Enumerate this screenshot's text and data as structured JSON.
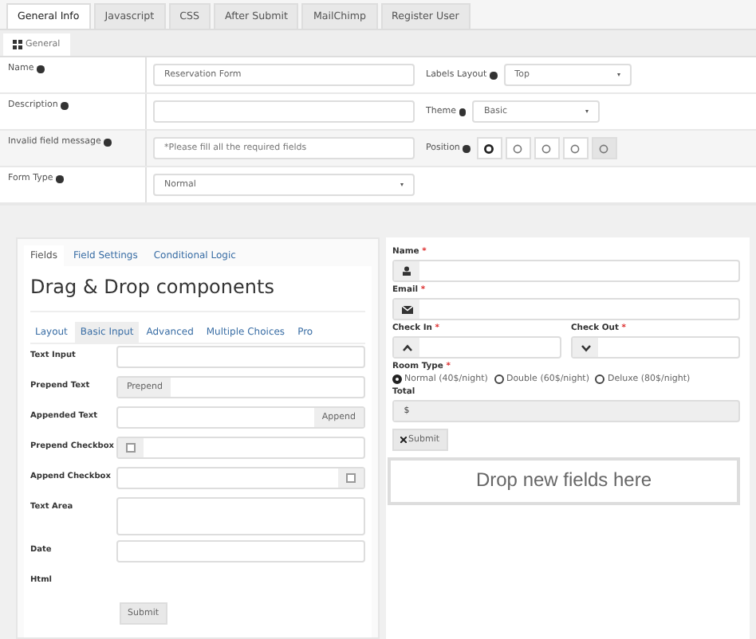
{
  "tabs": [
    {
      "label": "General Info",
      "selected": true
    },
    {
      "label": "Javascript",
      "selected": false
    },
    {
      "label": "CSS",
      "selected": false
    },
    {
      "label": "After Submit",
      "selected": false
    },
    {
      "label": "MailChimp",
      "selected": false
    },
    {
      "label": "Register User",
      "selected": false
    }
  ],
  "subtab": {
    "label": "General",
    "selected": true
  },
  "settings": [
    {
      "label": "Name",
      "kind": "text",
      "value": "Reservation Form",
      "side": {
        "label": "Labels Layout",
        "kind": "select",
        "value": "Top"
      }
    },
    {
      "label": "Description",
      "kind": "text",
      "side": {
        "label": "Theme",
        "kind": "select",
        "value": "Basic"
      }
    },
    {
      "label": "Invalid field message",
      "kind": "text",
      "placeholder": "*Please fill all the required fields",
      "side": {
        "label": "Position",
        "kind": "position",
        "buttons": [
          {
            "selected": false
          },
          {
            "selected": false
          },
          {
            "selected": false
          },
          {
            "selected": false
          },
          {
            "selected": true
          }
        ]
      }
    },
    {
      "label": "Form Type",
      "kind": "select",
      "value": "Normal"
    }
  ],
  "builder": {
    "tabs": [
      {
        "label": "Fields",
        "selected": true
      },
      {
        "label": "Field Settings",
        "selected": false
      },
      {
        "label": "Conditional Logic",
        "selected": false
      }
    ],
    "heading": "Drag & Drop components",
    "categories": [
      {
        "label": "Layout",
        "selected": false
      },
      {
        "label": "Basic Input",
        "selected": true
      },
      {
        "label": "Advanced",
        "selected": false
      },
      {
        "label": "Multiple Choices",
        "selected": false
      },
      {
        "label": "Pro",
        "selected": false
      }
    ],
    "components": [
      {
        "label": "Text Input",
        "kind": "input"
      },
      {
        "label": "Prepend Text",
        "kind": "prepend",
        "addon": "Prepend"
      },
      {
        "label": "Appended Text",
        "kind": "append",
        "addon": "Append"
      },
      {
        "label": "Prepend Checkbox",
        "kind": "prepend_checkbox",
        "checked": false
      },
      {
        "label": "Append Checkbox",
        "kind": "append_checkbox",
        "checked": false
      },
      {
        "label": "Text Area",
        "kind": "textarea"
      },
      {
        "label": "Date",
        "kind": "input"
      },
      {
        "label": "Html",
        "kind": "html"
      }
    ],
    "submit": "Submit"
  },
  "preview": {
    "name": {
      "label": "Name",
      "mark": "*"
    },
    "email": {
      "label": "Email",
      "mark": "*"
    },
    "check_in": {
      "label": "Check In",
      "mark": "*"
    },
    "check_out": {
      "label": "Check Out",
      "mark": "*"
    },
    "room_type": {
      "label": "Room Type",
      "mark": "*",
      "options": [
        {
          "label": "Normal (40$/night)",
          "selected": true
        },
        {
          "label": "Double (60$/night)",
          "selected": false
        },
        {
          "label": "Deluxe (80$/night)",
          "selected": false
        }
      ]
    },
    "total": {
      "label": "Total",
      "prefix": "$"
    },
    "submit": "Submit",
    "dropzone": "Drop new fields here"
  }
}
